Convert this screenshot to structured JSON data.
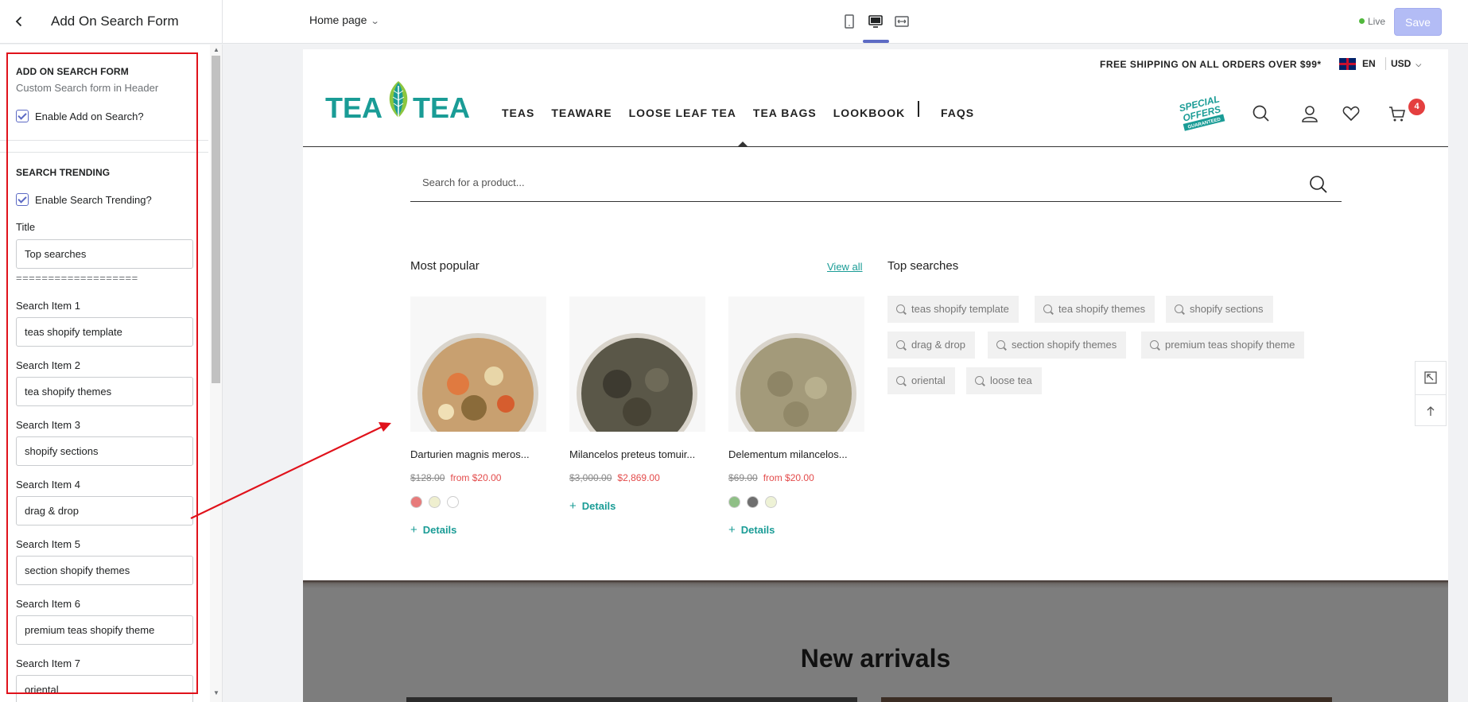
{
  "editor": {
    "sidebar_title": "Add On Search Form",
    "page_select": "Home page",
    "status": "Live",
    "save_label": "Save"
  },
  "sidebar": {
    "section1_heading": "ADD ON SEARCH FORM",
    "section1_sub": "Custom Search form in Header",
    "enable_search_label": "Enable Add on Search?",
    "section2_heading": "SEARCH TRENDING",
    "enable_trending_label": "Enable Search Trending?",
    "title_label": "Title",
    "title_value": "Top searches",
    "separator": "===================",
    "items": [
      {
        "label": "Search Item 1",
        "value": "teas shopify template"
      },
      {
        "label": "Search Item 2",
        "value": "tea shopify themes"
      },
      {
        "label": "Search Item 3",
        "value": "shopify sections"
      },
      {
        "label": "Search Item 4",
        "value": "drag & drop"
      },
      {
        "label": "Search Item 5",
        "value": "section shopify themes"
      },
      {
        "label": "Search Item 6",
        "value": "premium teas shopify theme"
      },
      {
        "label": "Search Item 7",
        "value": "oriental"
      }
    ]
  },
  "store": {
    "shipping_note": "FREE SHIPPING ON ALL ORDERS OVER $99*",
    "language": "EN",
    "currency": "USD",
    "logo_text_left": "TEA",
    "logo_text_right": "TEA",
    "nav": [
      "TEAS",
      "TEAWARE",
      "LOOSE LEAF TEA",
      "TEA BAGS",
      "LOOKBOOK"
    ],
    "nav_faq": "FAQS",
    "special_offer": [
      "SPECIAL",
      "OFFERS",
      "GUARANTEED"
    ],
    "cart_count": "4",
    "search_placeholder": "Search for a product...",
    "most_popular_title": "Most popular",
    "view_all": "View all",
    "top_searches_title": "Top searches",
    "products": [
      {
        "name": "Darturien magnis meros...",
        "old_price": "$128.00",
        "new_price": "from $20.00",
        "swatches": [
          "#e77b7b",
          "#efefcf",
          "#ffffff"
        ],
        "details": "Details"
      },
      {
        "name": "Milancelos preteus tomuir...",
        "old_price": "$3,000.00",
        "new_price": "$2,869.00",
        "swatches": [],
        "details": "Details"
      },
      {
        "name": "Delementum milancelos...",
        "old_price": "$69.00",
        "new_price": "from $20.00",
        "swatches": [
          "#8fbf86",
          "#6f6f6f",
          "#eef2d6"
        ],
        "details": "Details"
      }
    ],
    "tags": [
      "teas shopify template",
      "tea shopify themes",
      "shopify sections",
      "drag & drop",
      "section shopify themes",
      "premium teas shopify theme",
      "oriental",
      "loose tea"
    ],
    "banner_title": "New arrivals"
  },
  "colors": {
    "accent": "#5c6ac4",
    "teal": "#1a9c96",
    "sale_red": "#e34b4b",
    "annotation_red": "#e0121b"
  }
}
